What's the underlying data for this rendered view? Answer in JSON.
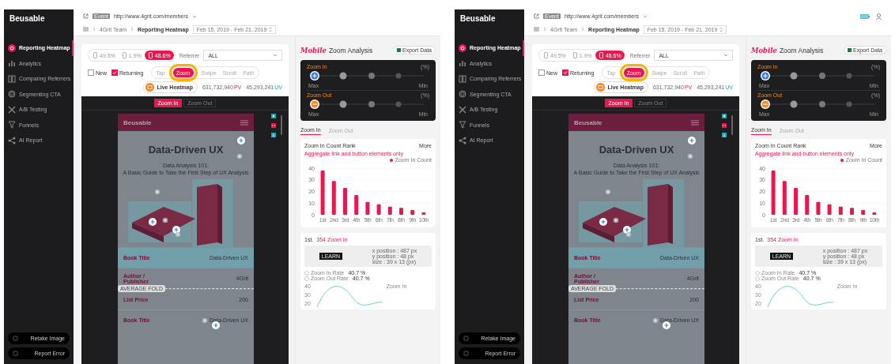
{
  "screens": [
    {
      "logo": "Beusable",
      "status_icons": false,
      "url_badge": "Event",
      "url": "http://www.4grit.com/members",
      "breadcrumb": [
        "4Grit Team",
        "Reporting Heatmap"
      ],
      "date_range": "Feb 15, 2019 - Feb 21, 2019",
      "sidebar": {
        "items": [
          {
            "label": "Reporting Heatmap",
            "selected": true
          },
          {
            "label": "Analytics",
            "selected": false
          },
          {
            "label": "Comparing Referrers",
            "selected": false
          },
          {
            "label": "Segmenting CTA",
            "selected": false
          },
          {
            "label": "A/B Testing",
            "selected": false
          },
          {
            "label": "Funnels",
            "selected": false
          },
          {
            "label": "AI Report",
            "selected": false
          }
        ],
        "buttons": [
          "Retake Image",
          "Report Error"
        ]
      },
      "device_tabs": [
        {
          "label": "49.5%",
          "selected": false
        },
        {
          "label": "1.9%",
          "selected": false
        },
        {
          "label": "48.6%",
          "selected": true
        }
      ],
      "referrer": {
        "label": "Referrer",
        "value": "ALL"
      },
      "visitor_filters": [
        {
          "label": "New",
          "checked": false
        },
        {
          "label": "Returning",
          "checked": true
        }
      ],
      "modes": [
        {
          "label": "Tap",
          "selected": false
        },
        {
          "label": "Zoom",
          "selected": true
        },
        {
          "label": "Swipe",
          "selected": false
        },
        {
          "label": "Scroll",
          "selected": false
        },
        {
          "label": "Path",
          "selected": false
        }
      ],
      "live_button": "Live Heatmap",
      "stats": [
        {
          "value": "631,732,940",
          "unit": "PV"
        },
        {
          "value": "45,293,241",
          "unit": "UV"
        }
      ],
      "highlight": true,
      "zoom_toggle": [
        {
          "label": "Zoom In",
          "selected": true
        },
        {
          "label": "Zoom Out",
          "selected": false
        }
      ],
      "preview": {
        "logo": "Beusable",
        "title": "Data-Driven UX",
        "subtitle": [
          "Data Analysis 101:",
          "A Basic Guide to Take the First Step of UX Analysis"
        ],
        "rows": [
          {
            "label": "Book Title",
            "value": "Data-Driven UX"
          },
          {
            "label": "Author / Publisher",
            "value": "4Grit"
          },
          {
            "label": "List Price",
            "value": "200"
          },
          {
            "label": "Book Title",
            "value": "Data-Driven UX"
          }
        ],
        "fold_label": "AVERAGE FOLD"
      },
      "analysis": {
        "title_em": "Mobile",
        "title": "Zoom Analysis",
        "export": "Export Data",
        "groups": [
          {
            "kind": "in",
            "title": "Zoom In",
            "unit": "(%)",
            "max": "Max",
            "min": "Min"
          },
          {
            "kind": "out",
            "title": "Zoom Out",
            "unit": "(%)",
            "max": "Max",
            "min": "Min"
          }
        ],
        "tabs": [
          {
            "label": "Zoom In",
            "selected": true
          },
          {
            "label": "Zoom Out",
            "selected": false
          }
        ],
        "rank_card": {
          "title": "Zoom In Count Rank",
          "more": "More",
          "note": "Aggregate link and button elements only",
          "chart_data": {
            "type": "bar",
            "categories": [
              "1st",
              "2nd",
              "3rd",
              "4th",
              "5th",
              "6th",
              "7th",
              "8th",
              "9th",
              "10th"
            ],
            "series": [
              {
                "name": "Zoom In Count",
                "color": "#e8174f",
                "values": [
                  38,
                  29,
                  23,
                  17,
                  11,
                  9,
                  7,
                  6,
                  4,
                  2
                ]
              }
            ],
            "ylim": [
              0,
              40
            ],
            "yticks": [
              0,
              10,
              20,
              30,
              40
            ],
            "grid": true
          }
        },
        "detail_card": {
          "rank": "1st.",
          "headline": "354 Zoom In",
          "thumb_label": "LEARN",
          "info": [
            "x position : 487 px",
            "y position : 48 px",
            "size : 39 x 13 (px)"
          ],
          "rates": [
            {
              "label": "Zoom In Rate",
              "value": "40.7 %"
            },
            {
              "label": "Zoom Out Rate",
              "value": "40.7 %"
            }
          ],
          "legend": "Zoom In",
          "y_labels": [
            "40",
            "30",
            "20"
          ]
        }
      }
    },
    {
      "logo": "Beusable",
      "status_icons": true,
      "url_badge": "Event",
      "url": "http://www.4grit.com/members",
      "breadcrumb": [
        "4Grit Team",
        "Reporting Heatmap"
      ],
      "date_range": "Feb 15, 2019 - Feb 21, 2019",
      "sidebar": {
        "items": [
          {
            "label": "Reporting Heatmap",
            "selected": true
          },
          {
            "label": "Analytics",
            "selected": false
          },
          {
            "label": "Comparing Referrers",
            "selected": false
          },
          {
            "label": "Segmenting CTA",
            "selected": false
          },
          {
            "label": "A/B Testing",
            "selected": false
          },
          {
            "label": "Funnels",
            "selected": false
          },
          {
            "label": "AI Report",
            "selected": false
          }
        ],
        "buttons": [
          "Retake Image",
          "Report Error"
        ]
      },
      "device_tabs": [
        {
          "label": "49.5%",
          "selected": false
        },
        {
          "label": "1.9%",
          "selected": false
        },
        {
          "label": "48.6%",
          "selected": true
        }
      ],
      "referrer": {
        "label": "Referrer",
        "value": "ALL"
      },
      "visitor_filters": [
        {
          "label": "New",
          "checked": false
        },
        {
          "label": "Returning",
          "checked": true
        }
      ],
      "modes": [
        {
          "label": "Tap",
          "selected": false
        },
        {
          "label": "Zoom",
          "selected": true
        },
        {
          "label": "Swipe",
          "selected": false
        },
        {
          "label": "Scroll",
          "selected": false
        },
        {
          "label": "Path",
          "selected": false
        }
      ],
      "live_button": "Live Heatmap",
      "stats": [
        {
          "value": "631,732,940",
          "unit": "PV"
        },
        {
          "value": "45,293,241",
          "unit": "UV"
        }
      ],
      "highlight": true,
      "zoom_toggle": [
        {
          "label": "Zoom In",
          "selected": true
        },
        {
          "label": "Zoom Out",
          "selected": false
        }
      ],
      "preview": {
        "logo": "Beusable",
        "title": "Data-Driven UX",
        "subtitle": [
          "Data Analysis 101:",
          "A Basic Guide to Take the First Step of UX Analysis"
        ],
        "rows": [
          {
            "label": "Book Title",
            "value": "Data-Driven UX"
          },
          {
            "label": "Author / Publisher",
            "value": "4Grit"
          },
          {
            "label": "List Price",
            "value": "200"
          },
          {
            "label": "Book Title",
            "value": "Data-Driven UX"
          }
        ],
        "fold_label": "AVERAGE FOLD"
      },
      "analysis": {
        "title_em": "Mobile",
        "title": "Zoom Analysis",
        "export": "Export Data",
        "groups": [
          {
            "kind": "in",
            "title": "Zoom In",
            "unit": "(%)",
            "max": "Max",
            "min": "Min"
          },
          {
            "kind": "out",
            "title": "Zoom Out",
            "unit": "(%)",
            "max": "Max",
            "min": "Min"
          }
        ],
        "tabs": [
          {
            "label": "Zoom In",
            "selected": true
          },
          {
            "label": "Zoom Out",
            "selected": false
          }
        ],
        "rank_card": {
          "title": "Zoom In Count Rank",
          "more": "More",
          "note": "Aggregate link and button elements only",
          "chart_data": {
            "type": "bar",
            "categories": [
              "1st",
              "2nd",
              "3rd",
              "4th",
              "5th",
              "6th",
              "7th",
              "8th",
              "9th",
              "10th"
            ],
            "series": [
              {
                "name": "Zoom In Count",
                "color": "#e8174f",
                "values": [
                  38,
                  29,
                  23,
                  17,
                  11,
                  9,
                  7,
                  6,
                  4,
                  2
                ]
              }
            ],
            "ylim": [
              0,
              40
            ],
            "yticks": [
              0,
              10,
              20,
              30,
              40
            ],
            "grid": true
          }
        },
        "detail_card": {
          "rank": "1st.",
          "headline": "354 Zoom In",
          "thumb_label": "LEARN",
          "info": [
            "x position : 487 px",
            "y position : 48 px",
            "size : 39 x 13 (px)"
          ],
          "rates": [
            {
              "label": "Zoom In Rate",
              "value": "40.7 %"
            },
            {
              "label": "Zoom Out Rate",
              "value": "40.7 %"
            }
          ],
          "legend": "Zoom In",
          "y_labels": [
            "40",
            "30",
            "20"
          ]
        }
      }
    }
  ]
}
